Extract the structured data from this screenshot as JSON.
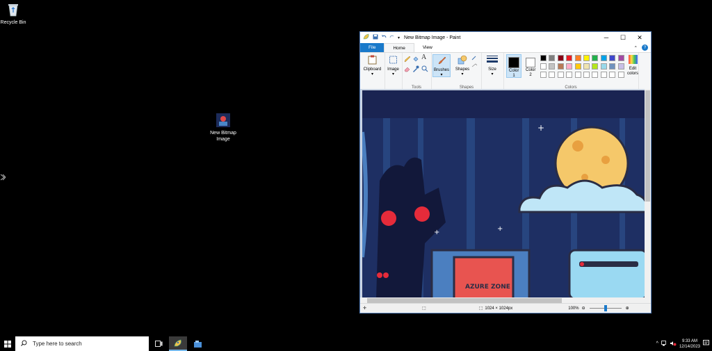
{
  "desktop": {
    "icons": [
      {
        "label": "Recycle Bin"
      },
      {
        "label": "New Bitmap Image"
      }
    ]
  },
  "paint": {
    "title": "New Bitmap Image - Paint",
    "tabs": [
      "File",
      "Home",
      "View"
    ],
    "groups": {
      "clipboard": "Clipboard",
      "image": "Image",
      "tools": "Tools",
      "brushes": "Brushes",
      "shapes": "Shapes",
      "shapes_label": "Shapes",
      "size": "Size",
      "color1": "Color 1",
      "color2": "Color 2",
      "colors": "Colors",
      "edit_colors": "Edit colors"
    },
    "palette_row1": [
      "#000000",
      "#7f7f7f",
      "#880015",
      "#ed1c24",
      "#ff7f27",
      "#fff200",
      "#22b14c",
      "#00a2e8",
      "#3f48cc",
      "#a349a4"
    ],
    "palette_row2": [
      "#ffffff",
      "#c3c3c3",
      "#b97a57",
      "#ffaec9",
      "#ffc90e",
      "#efe4b0",
      "#b5e61d",
      "#99d9ea",
      "#7092be",
      "#c8bfe7"
    ],
    "canvas_text": "AZURE ZONE",
    "status": {
      "image_size": "1024 × 1024px",
      "zoom": "100%",
      "zoom_level": 0.5
    }
  },
  "taskbar": {
    "search_placeholder": "Type here to search",
    "time": "9:33 AM",
    "date": "12/14/2023"
  }
}
